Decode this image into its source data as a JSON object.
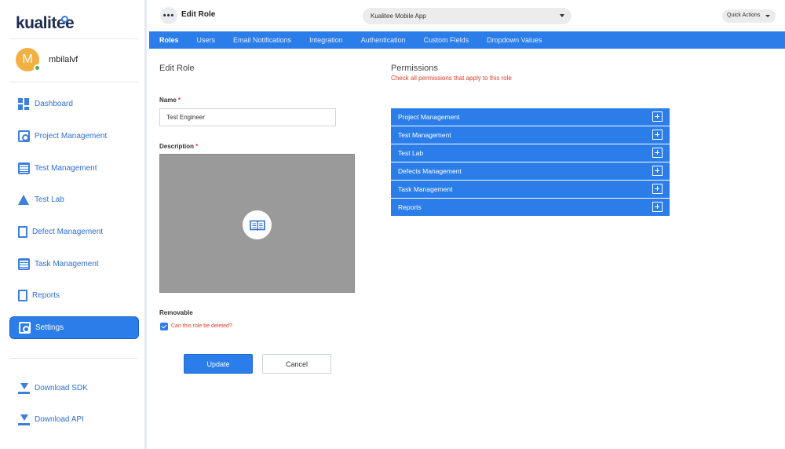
{
  "app": {
    "logo_text": "kualitee",
    "page_title": "Edit Role",
    "project_selector": "Kualitee Mobile App",
    "quick_actions_label": "Quick Actions"
  },
  "user": {
    "initial": "M",
    "name": "mbilalvf"
  },
  "sidebar": {
    "items": [
      {
        "label": "Dashboard",
        "icon": "dashboard-icon"
      },
      {
        "label": "Project Management",
        "icon": "project-management-icon"
      },
      {
        "label": "Test Management",
        "icon": "test-management-icon"
      },
      {
        "label": "Test Lab",
        "icon": "flask-icon"
      },
      {
        "label": "Defect Management",
        "icon": "defect-icon"
      },
      {
        "label": "Task Management",
        "icon": "task-icon"
      },
      {
        "label": "Reports",
        "icon": "reports-icon"
      },
      {
        "label": "Settings",
        "icon": "settings-icon"
      }
    ],
    "downloads": [
      {
        "label": "Download SDK",
        "icon": "download-icon"
      },
      {
        "label": "Download API",
        "icon": "download-icon"
      }
    ]
  },
  "tabs": [
    "Roles",
    "Users",
    "Email Notifications",
    "Integration",
    "Authentication",
    "Custom Fields",
    "Dropdown Values"
  ],
  "active_tab": "Roles",
  "form": {
    "section_title": "Edit Role",
    "name_label": "Name",
    "name_value": "Test Engineer",
    "description_label": "Description",
    "removable_label": "Removable",
    "removable_checked": true,
    "removable_question": "Can this role be deleted?",
    "update_label": "Update",
    "cancel_label": "Cancel",
    "required_marker": "*"
  },
  "permissions": {
    "title": "Permissions",
    "subtitle": "Check all permissions that apply to this role",
    "groups": [
      "Project Management",
      "Test Management",
      "Test Lab",
      "Defects Management",
      "Task Management",
      "Reports"
    ]
  },
  "colors": {
    "accent": "#2b7de9",
    "required": "#e23d28",
    "avatar": "#f2b043"
  }
}
